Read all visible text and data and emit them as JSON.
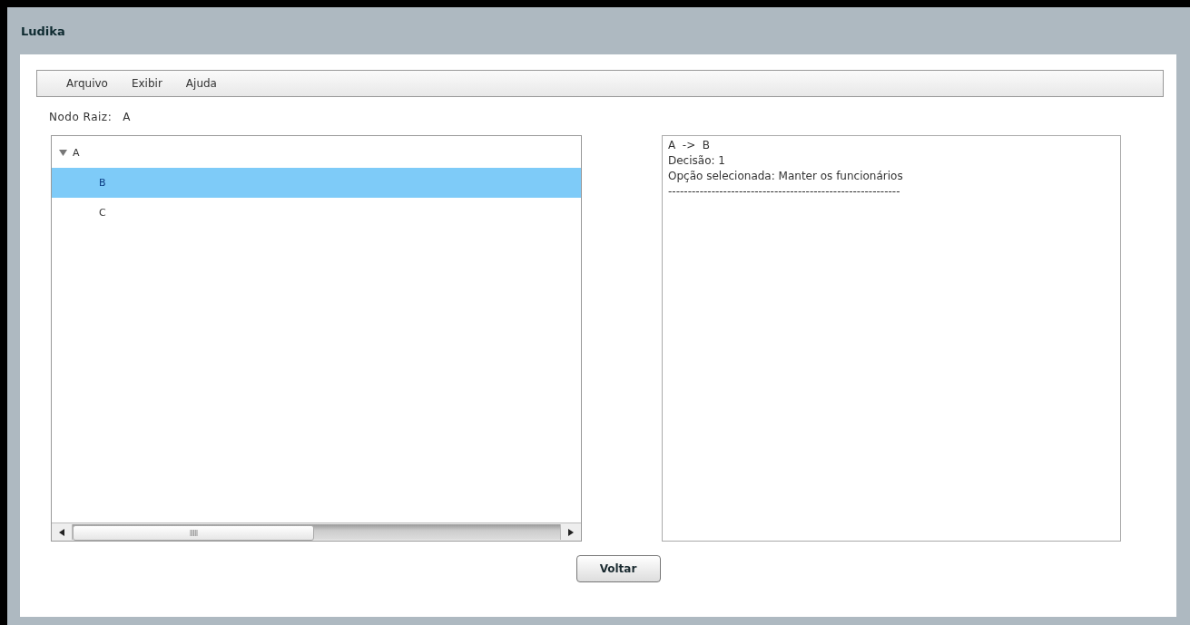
{
  "window": {
    "title": "Ludika"
  },
  "menu": [
    "Arquivo",
    "Exibir",
    "Ajuda"
  ],
  "root_node": {
    "label": "Nodo Raiz:",
    "value": "A"
  },
  "tree": [
    {
      "label": "A",
      "expanded": true,
      "selected": false,
      "children": [
        {
          "label": "B",
          "selected": true
        },
        {
          "label": "C",
          "selected": false
        }
      ]
    }
  ],
  "log": [
    "A  ->  B",
    "Decisão: 1",
    "Opção selecionada: Manter os funcionários",
    "-----------------------------------------------------------"
  ],
  "buttons": [
    "Voltar"
  ]
}
